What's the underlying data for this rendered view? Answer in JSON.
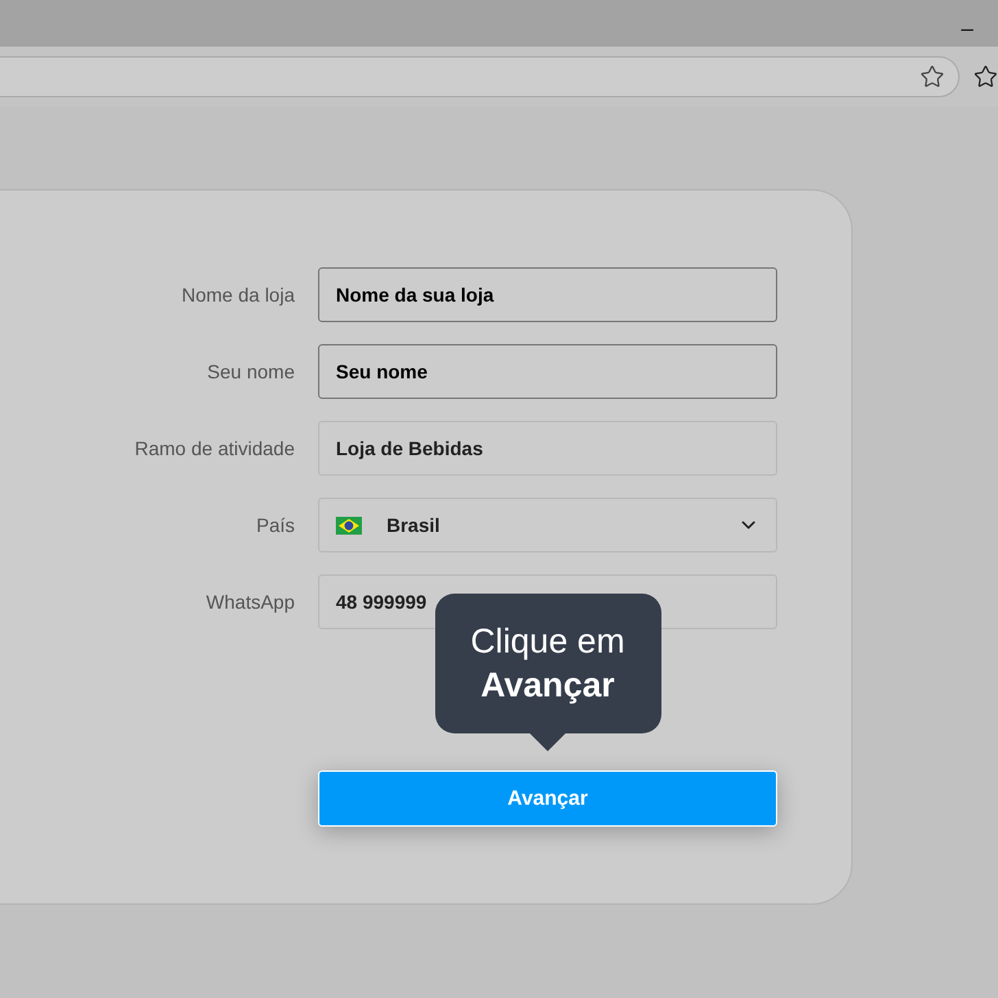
{
  "window": {
    "minimize": "–"
  },
  "form": {
    "fields": [
      {
        "label": "Nome da loja",
        "kind": "text",
        "value": "Nome da sua loja",
        "highlighted": true
      },
      {
        "label": "Seu nome",
        "kind": "text",
        "value": "Seu nome",
        "highlighted": true
      },
      {
        "label": "Ramo de atividade",
        "kind": "text",
        "value": "Loja de Bebidas",
        "highlighted": false
      },
      {
        "label": "País",
        "kind": "select",
        "value": "Brasil",
        "highlighted": false
      },
      {
        "label": "WhatsApp",
        "kind": "text",
        "value": "48 999999",
        "highlighted": false
      }
    ],
    "submit": "Avançar"
  },
  "tooltip": {
    "text": "Clique em **Avançar**"
  }
}
